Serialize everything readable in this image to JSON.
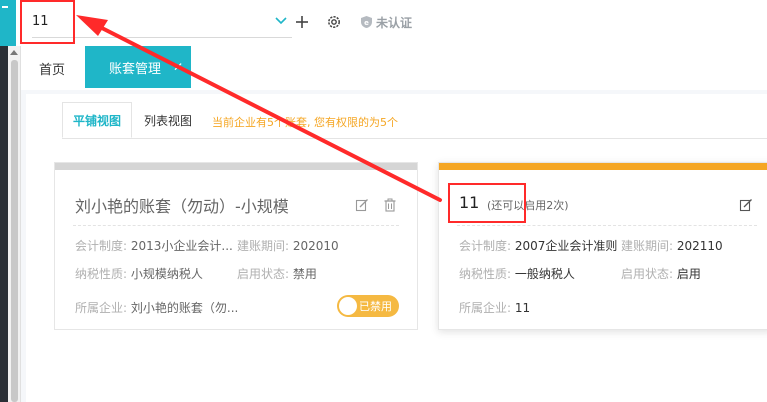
{
  "header": {
    "company_value": "11",
    "auth_label": "未认证",
    "icons": [
      "plus-icon",
      "gear-icon",
      "shield-badge-icon",
      "chevron-down-icon"
    ]
  },
  "tabs": {
    "home": "首页",
    "active": "账套管理",
    "close_glyph": "✕"
  },
  "view": {
    "tab_grid": "平铺视图",
    "tab_list": "列表视图",
    "note": "当前企业有5个账套, 您有权限的为5个"
  },
  "cards": [
    {
      "title": "刘小艳的账套（勿动）-小规模",
      "system_label": "会计制度:",
      "system_value": "2013小企业会计...",
      "period_label": "建账期间:",
      "period_value": "202010",
      "tax_label": "纳税性质:",
      "tax_value": "小规模纳税人",
      "status_label": "启用状态:",
      "status_value": "禁用",
      "company_label": "所属企业:",
      "company_value": "刘小艳的账套（勿...",
      "toggle_label": "已禁用"
    },
    {
      "title": "11",
      "subtitle": "(还可以启用2次)",
      "system_label": "会计制度:",
      "system_value": "2007企业会计准则",
      "period_label": "建账期间:",
      "period_value": "202110",
      "tax_label": "纳税性质:",
      "tax_value": "一般纳税人",
      "status_label": "启用状态:",
      "status_value": "启用",
      "company_label": "所属企业:",
      "company_value": "11"
    }
  ],
  "colors": {
    "accent": "#1fb6c8",
    "warning": "#f5a623",
    "annotation": "#ff2a2a"
  }
}
